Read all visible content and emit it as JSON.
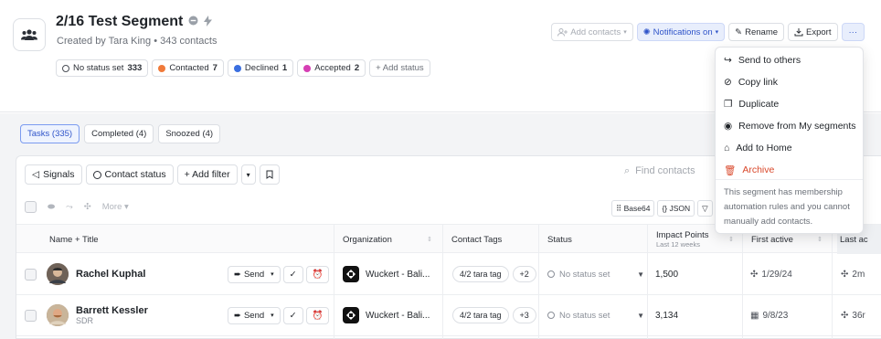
{
  "segment": {
    "title": "2/16 Test Segment",
    "subtitle": "Created by Tara King • 343 contacts"
  },
  "statuses": [
    {
      "label": "No status set",
      "count": "333",
      "color": "#ffffff"
    },
    {
      "label": "Contacted",
      "count": "7",
      "color": "#f07a3a"
    },
    {
      "label": "Declined",
      "count": "1",
      "color": "#3b6fe0"
    },
    {
      "label": "Accepted",
      "count": "2",
      "color": "#d63fb4"
    }
  ],
  "add_status_label": "+ Add status",
  "toolbar": {
    "add_contacts": "Add contacts",
    "notifications": "Notifications on",
    "rename": "Rename",
    "export": "Export",
    "more": "···"
  },
  "tabs": [
    "Tasks (335)",
    "Completed (4)",
    "Snoozed (4)"
  ],
  "filters": {
    "signals": "Signals",
    "contact_status": "Contact status",
    "add_filter": "+ Add filter"
  },
  "search_placeholder": "Find contacts",
  "bulk_actions": {
    "more": "More"
  },
  "export_buttons": {
    "base64": "Base64",
    "json": "JSON"
  },
  "columns": {
    "name": "Name + Title",
    "organization": "Organization",
    "contact_tags": "Contact Tags",
    "status": "Status",
    "impact": "Impact Points",
    "impact_sub": "Last 12 weeks",
    "first_active": "First active",
    "last_active": "Last ac"
  },
  "rows": [
    {
      "name": "Rachel Kuphal",
      "title": "",
      "send": "Send",
      "org": "Wuckert - Bali...",
      "tag": "4/2 tara tag",
      "tag_more": "+2",
      "status": "No status set",
      "impact": "1,500",
      "first_active": "1/29/24",
      "last_active": "2m"
    },
    {
      "name": "Barrett Kessler",
      "title": "SDR",
      "send": "Send",
      "org": "Wuckert - Bali...",
      "tag": "4/2 tara tag",
      "tag_more": "+3",
      "status": "No status set",
      "impact": "3,134",
      "first_active": "9/8/23",
      "last_active": "36r"
    }
  ],
  "menu": {
    "items": [
      "Send to others",
      "Copy link",
      "Duplicate",
      "Remove from My segments",
      "Add to Home",
      "Archive"
    ],
    "note": "This segment has membership automation rules and you cannot manually add contacts."
  },
  "colors": {
    "accent": "#2f54c9",
    "danger": "#d9482b"
  }
}
